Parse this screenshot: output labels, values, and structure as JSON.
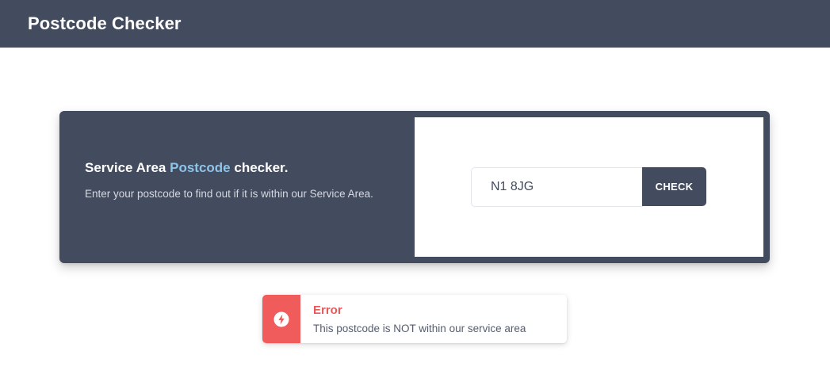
{
  "header": {
    "title": "Postcode Checker"
  },
  "checker": {
    "heading_prefix": "Service Area ",
    "heading_accent": "Postcode",
    "heading_suffix": " checker.",
    "description": "Enter your postcode to find out if it is within our Service Area.",
    "postcode_value": "N1 8JG",
    "check_label": "CHECK"
  },
  "alert": {
    "icon": "lightning-bolt-icon",
    "title": "Error",
    "message": "This postcode is NOT within our service area"
  },
  "colors": {
    "navy": "#434b5f",
    "accent": "#8fc4ea",
    "error": "#f05c5c",
    "error_text": "#e85959"
  }
}
